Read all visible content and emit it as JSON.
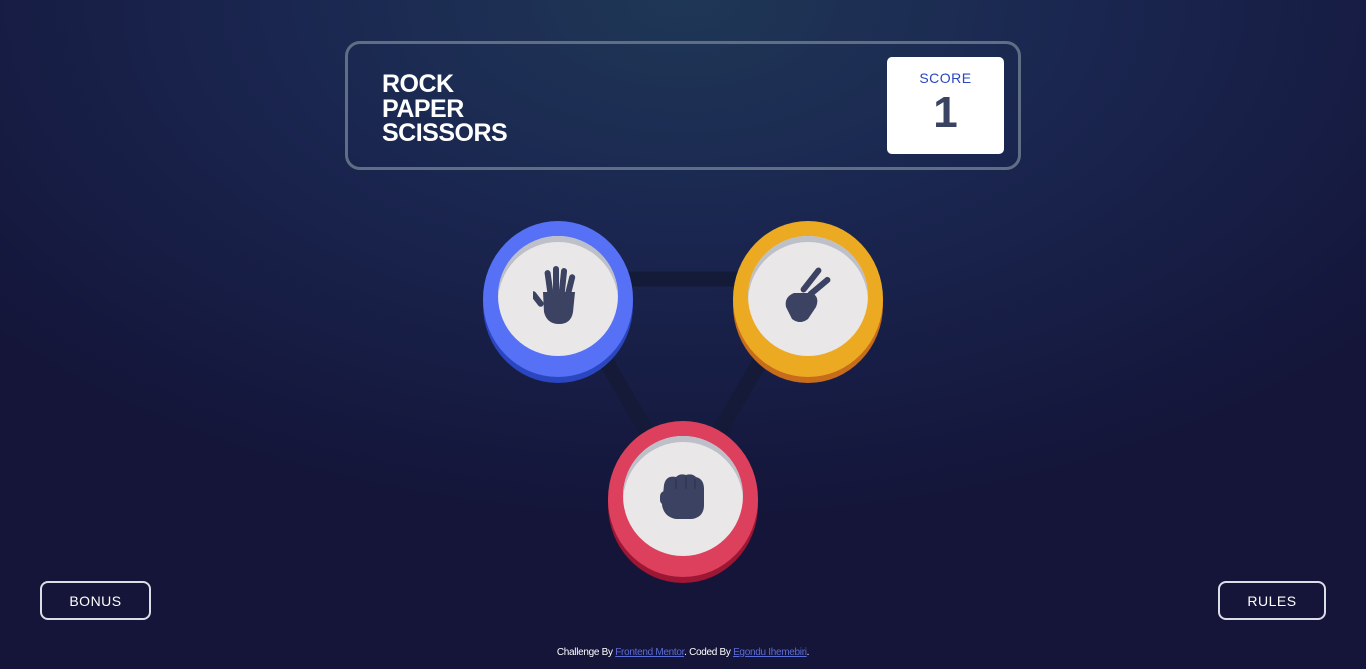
{
  "header": {
    "title_lines": [
      "ROCK",
      "PAPER",
      "SCISSORS"
    ],
    "score_label": "SCORE",
    "score_value": "1"
  },
  "tokens": [
    {
      "name": "paper",
      "icon": "paper-hand-icon",
      "ring_color": "#5671f5"
    },
    {
      "name": "scissors",
      "icon": "scissors-hand-icon",
      "ring_color": "#eca922"
    },
    {
      "name": "rock",
      "icon": "rock-fist-icon",
      "ring_color": "#dd405d"
    }
  ],
  "buttons": {
    "bonus": "BONUS",
    "rules": "RULES"
  },
  "footer": {
    "challenge_prefix": "Challenge By ",
    "challenge_link": "Frontend Mentor",
    "coded_prefix": ". Coded By ",
    "coded_link": "Egondu Ihemebiri",
    "suffix": "."
  }
}
